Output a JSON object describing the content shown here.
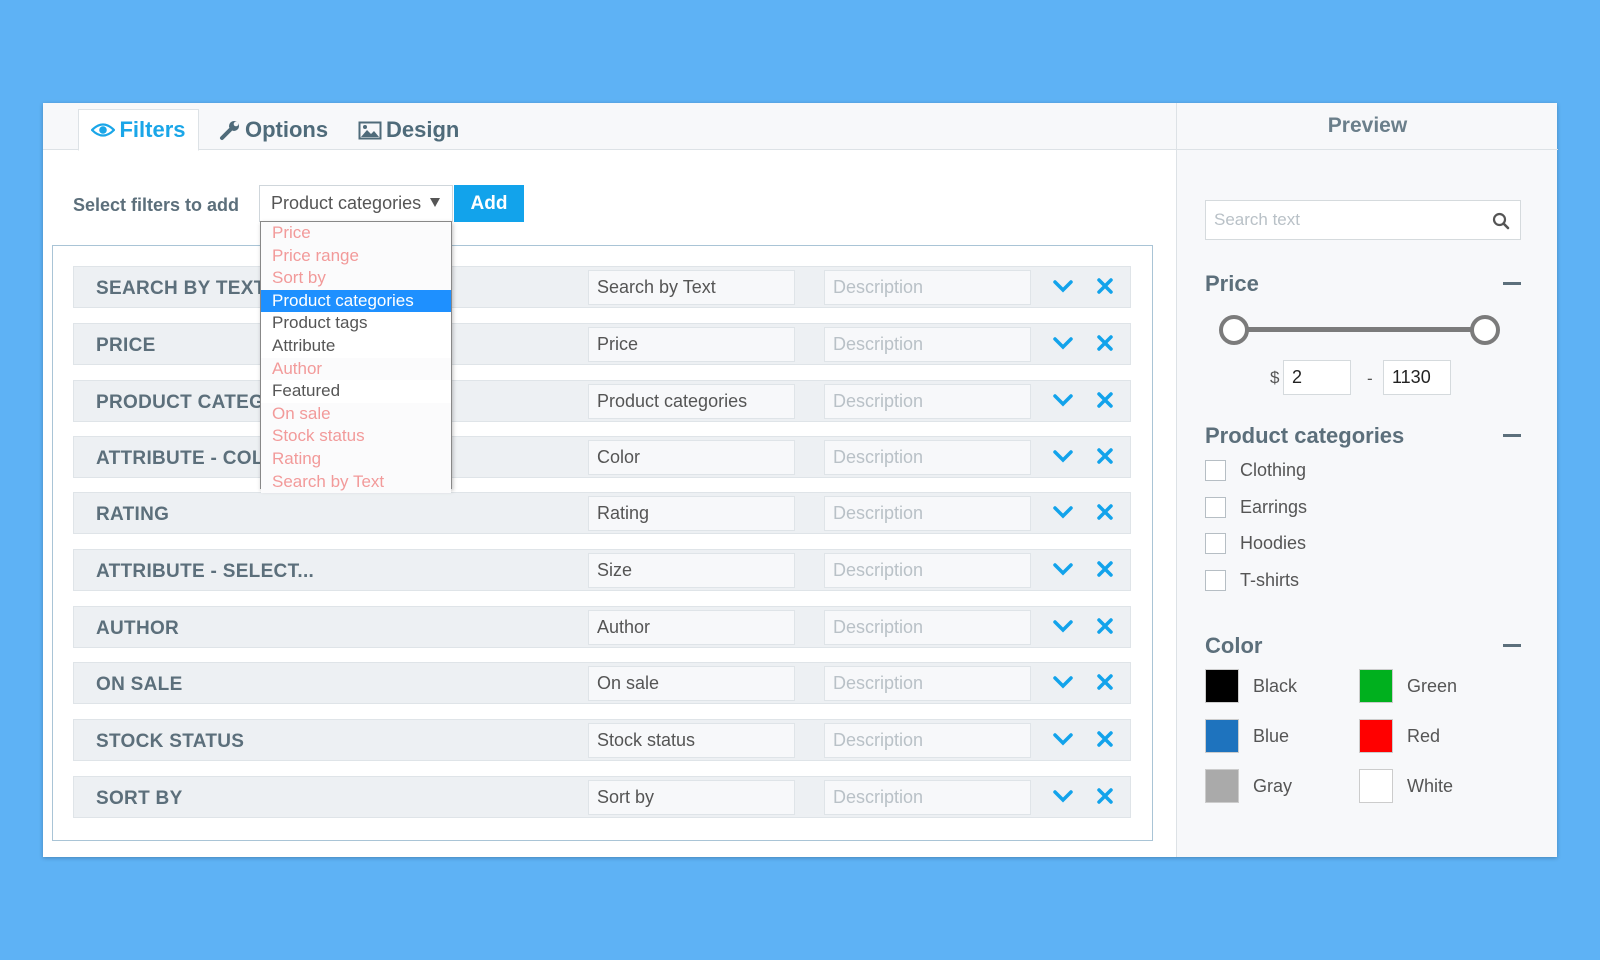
{
  "tabs": [
    {
      "label": "Filters",
      "icon": "eye-icon",
      "active": true
    },
    {
      "label": "Options",
      "icon": "wrench-icon",
      "active": false
    },
    {
      "label": "Design",
      "icon": "image-icon",
      "active": false
    }
  ],
  "filter_select": {
    "label": "Select filters to add",
    "selected": "Product categories",
    "add_label": "Add",
    "options": [
      {
        "label": "Price",
        "state": "disabled"
      },
      {
        "label": "Price range",
        "state": "disabled"
      },
      {
        "label": "Sort by",
        "state": "disabled"
      },
      {
        "label": "Product categories",
        "state": "selected"
      },
      {
        "label": "Product tags",
        "state": "enabled"
      },
      {
        "label": "Attribute",
        "state": "enabled"
      },
      {
        "label": "Author",
        "state": "disabled"
      },
      {
        "label": "Featured",
        "state": "enabled"
      },
      {
        "label": "On sale",
        "state": "disabled"
      },
      {
        "label": "Stock status",
        "state": "disabled"
      },
      {
        "label": "Rating",
        "state": "disabled"
      },
      {
        "label": "Search by Text",
        "state": "disabled"
      }
    ]
  },
  "filters": [
    {
      "title": "SEARCH BY TEXT",
      "name": "Search by Text",
      "description_placeholder": "Description"
    },
    {
      "title": "PRICE",
      "name": "Price",
      "description_placeholder": "Description"
    },
    {
      "title": "PRODUCT CATEGORIES",
      "name": "Product categories",
      "description_placeholder": "Description"
    },
    {
      "title": "ATTRIBUTE - COLOR",
      "name": "Color",
      "description_placeholder": "Description"
    },
    {
      "title": "RATING",
      "name": "Rating",
      "description_placeholder": "Description"
    },
    {
      "title": "ATTRIBUTE - SELECT...",
      "name": "Size",
      "description_placeholder": "Description"
    },
    {
      "title": "AUTHOR",
      "name": "Author",
      "description_placeholder": "Description"
    },
    {
      "title": "ON SALE",
      "name": "On sale",
      "description_placeholder": "Description"
    },
    {
      "title": "STOCK STATUS",
      "name": "Stock status",
      "description_placeholder": "Description"
    },
    {
      "title": "SORT BY",
      "name": "Sort by",
      "description_placeholder": "Description"
    }
  ],
  "preview": {
    "title": "Preview",
    "search_placeholder": "Search text",
    "price": {
      "title": "Price",
      "currency": "$",
      "separator": "-",
      "min": "2",
      "max": "1130"
    },
    "categories": {
      "title": "Product categories",
      "items": [
        "Clothing",
        "Earrings",
        "Hoodies",
        "T-shirts"
      ]
    },
    "color": {
      "title": "Color",
      "items": [
        {
          "label": "Black",
          "hex": "#000000"
        },
        {
          "label": "Green",
          "hex": "#00b01e"
        },
        {
          "label": "Blue",
          "hex": "#1e73be"
        },
        {
          "label": "Red",
          "hex": "#ff0000"
        },
        {
          "label": "Gray",
          "hex": "#aaaaaa"
        },
        {
          "label": "White",
          "hex": "#ffffff"
        }
      ]
    }
  },
  "colors": {
    "background": "#5eb2f5",
    "accent": "#12a3eb",
    "selected_option": "#1e90ff",
    "disabled_option": "#f29a9a"
  }
}
